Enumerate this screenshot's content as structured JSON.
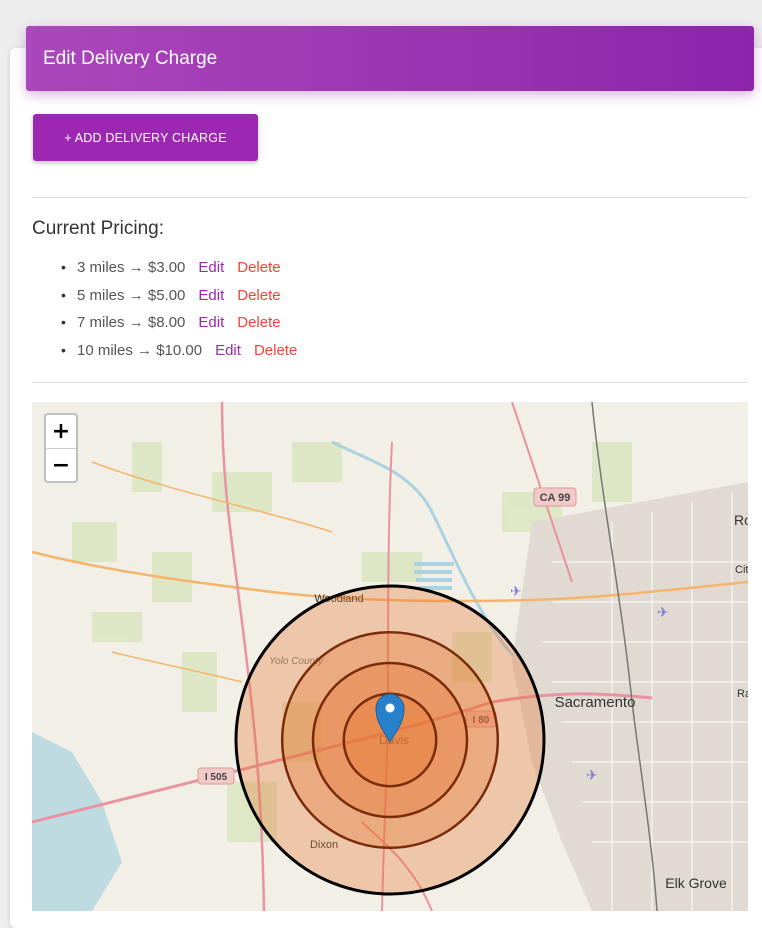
{
  "header": {
    "title": "Edit Delivery Charge"
  },
  "toolbar": {
    "add_label": "+ ADD DELIVERY CHARGE"
  },
  "pricing": {
    "title": "Current Pricing:",
    "items": [
      {
        "text": "3 miles → $3.00",
        "edit": "Edit",
        "delete": "Delete"
      },
      {
        "text": "5 miles → $5.00",
        "edit": "Edit",
        "delete": "Delete"
      },
      {
        "text": "7 miles → $8.00",
        "edit": "Edit",
        "delete": "Delete"
      },
      {
        "text": "10 miles → $10.00",
        "edit": "Edit",
        "delete": "Delete"
      }
    ]
  },
  "map": {
    "zoom_in": "+",
    "zoom_out": "−",
    "labels": {
      "woodland": "Woodland",
      "yolo": "Yolo County",
      "davis": "Davis",
      "dixon": "Dixon",
      "sacramento": "Sacramento",
      "elk_grove": "Elk Grove",
      "rancho": "Rancho",
      "citrus": "Cit",
      "ro": "Ro",
      "ca99": "CA 99",
      "i80": "I 80",
      "i505": "I 505"
    },
    "radius_miles": [
      10,
      7,
      5,
      3
    ],
    "colors": {
      "zone_fill": "#e8742e",
      "outer_ring": "#000000",
      "inner_ring": "#7a2c0a",
      "marker": "#2a81cb"
    }
  }
}
